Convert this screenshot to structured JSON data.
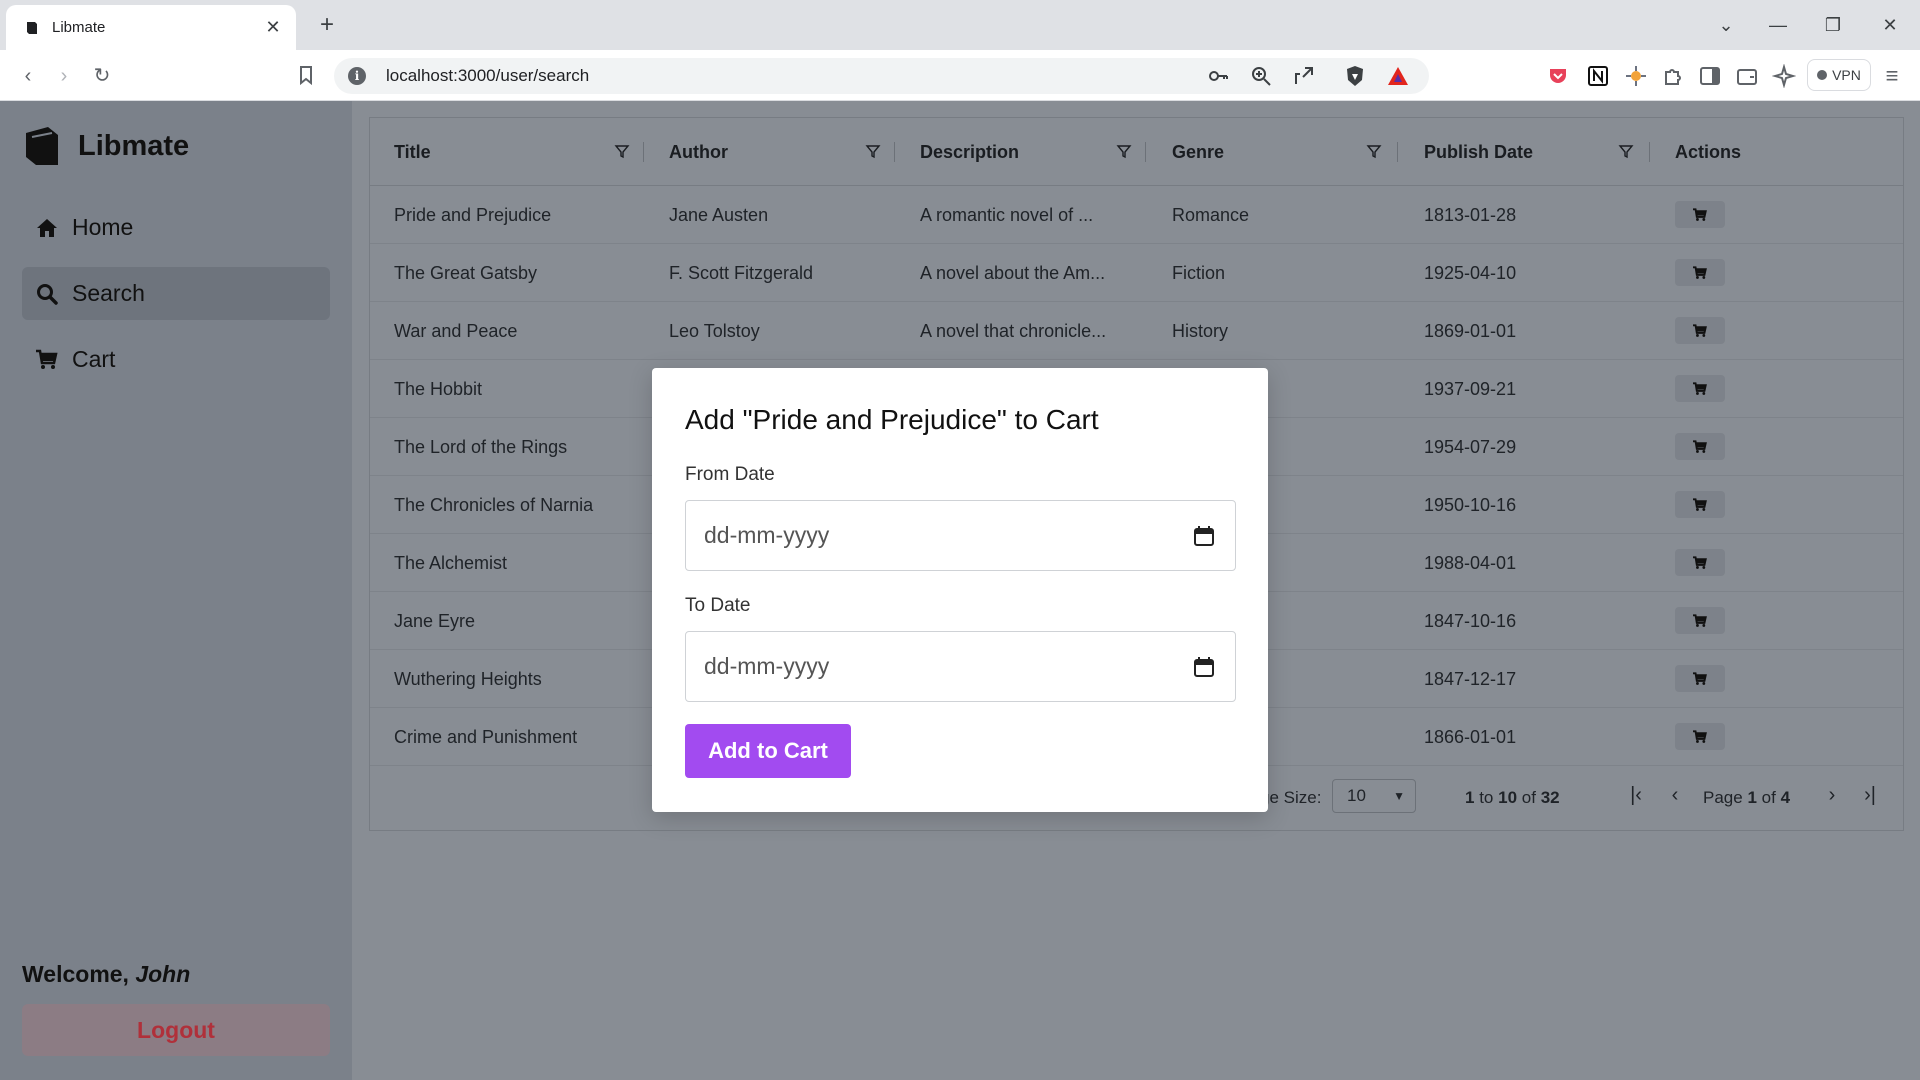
{
  "browser": {
    "tab_title": "Libmate",
    "tab_close": "✕",
    "new_tab": "+",
    "url": "localhost:3000/user/search",
    "vpn_label": "VPN",
    "window_controls": {
      "dropdown": "⌄",
      "minimize": "—",
      "restore": "❐",
      "close": "✕"
    }
  },
  "sidebar": {
    "brand": "Libmate",
    "items": [
      {
        "label": "Home",
        "icon": "home-icon"
      },
      {
        "label": "Search",
        "icon": "search-icon",
        "active": true
      },
      {
        "label": "Cart",
        "icon": "cart-icon"
      }
    ],
    "welcome_prefix": "Welcome, ",
    "user_name": "John",
    "logout_label": "Logout"
  },
  "table": {
    "columns": [
      "Title",
      "Author",
      "Description",
      "Genre",
      "Publish Date",
      "Actions"
    ],
    "rows": [
      {
        "title": "Pride and Prejudice",
        "author": "Jane Austen",
        "description": "A romantic novel of ...",
        "genre": "Romance",
        "date": "1813-01-28"
      },
      {
        "title": "The Great Gatsby",
        "author": "F. Scott Fitzgerald",
        "description": "A novel about the Am...",
        "genre": "Fiction",
        "date": "1925-04-10"
      },
      {
        "title": "War and Peace",
        "author": "Leo Tolstoy",
        "description": "A novel that chronicle...",
        "genre": "History",
        "date": "1869-01-01"
      },
      {
        "title": "The Hobbit",
        "author": "",
        "description": "",
        "genre": "",
        "date": "1937-09-21"
      },
      {
        "title": "The Lord of the Rings",
        "author": "",
        "description": "",
        "genre": "",
        "date": "1954-07-29"
      },
      {
        "title": "The Chronicles of Narnia",
        "author": "",
        "description": "",
        "genre": "",
        "date": "1950-10-16"
      },
      {
        "title": "The Alchemist",
        "author": "",
        "description": "",
        "genre": "",
        "date": "1988-04-01"
      },
      {
        "title": "Jane Eyre",
        "author": "",
        "description": "",
        "genre": "",
        "date": "1847-10-16"
      },
      {
        "title": "Wuthering Heights",
        "author": "",
        "description": "",
        "genre": "",
        "date": "1847-12-17"
      },
      {
        "title": "Crime and Punishment",
        "author": "",
        "description": "",
        "genre": "",
        "date": "1866-01-01"
      }
    ],
    "footer": {
      "page_size_label": "ge Size:",
      "page_size_value": "10",
      "row_from": "1",
      "row_to": "10",
      "row_total": "32",
      "to_word": "to",
      "of_word": "of",
      "page_word": "Page",
      "page_current": "1",
      "page_total": "4"
    }
  },
  "modal": {
    "title": "Add \"Pride and Prejudice\" to Cart",
    "from_label": "From Date",
    "from_placeholder": "dd-mm-yyyy",
    "to_label": "To Date",
    "to_placeholder": "dd-mm-yyyy",
    "button_label": "Add to Cart"
  },
  "colors": {
    "accent": "#a24bf0",
    "logout_text": "#b0303a",
    "overlay": "#888d94"
  }
}
